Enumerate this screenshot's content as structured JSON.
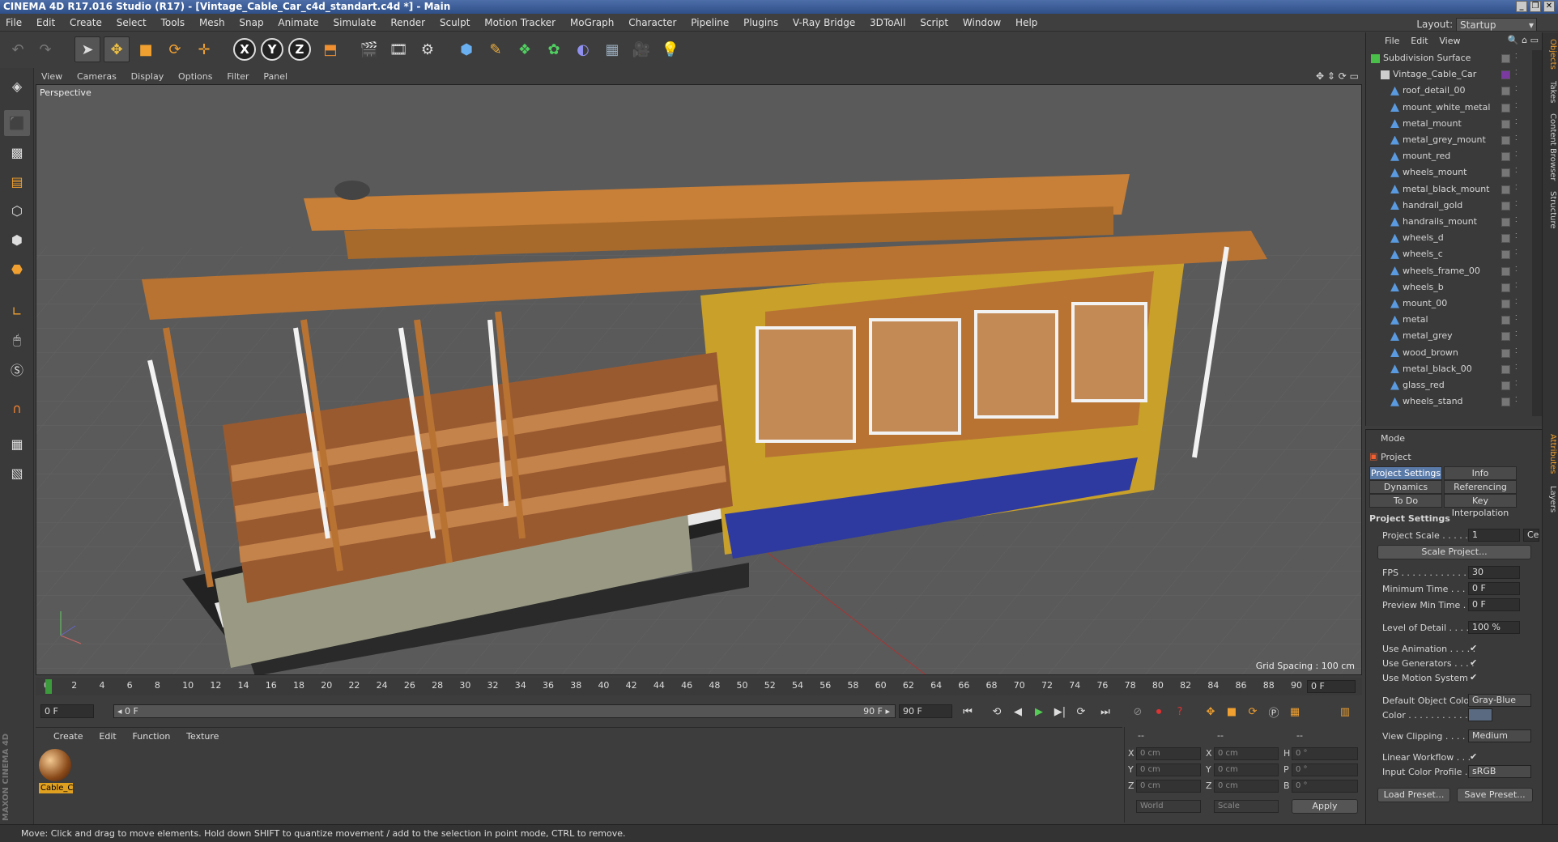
{
  "window": {
    "title": "CINEMA 4D R17.016 Studio (R17) - [Vintage_Cable_Car_c4d_standart.c4d *] - Main",
    "layout_label": "Layout:",
    "layout_value": "Startup",
    "min": "_",
    "max": "❐",
    "close": "✕"
  },
  "menu": [
    "File",
    "Edit",
    "Create",
    "Select",
    "Tools",
    "Mesh",
    "Snap",
    "Animate",
    "Simulate",
    "Render",
    "Sculpt",
    "Motion Tracker",
    "MoGraph",
    "Character",
    "Pipeline",
    "Plugins",
    "V-Ray Bridge",
    "3DToAll",
    "Script",
    "Window",
    "Help"
  ],
  "toolbar": {
    "axis_x": "X",
    "axis_y": "Y",
    "axis_z": "Z"
  },
  "viewport": {
    "menu": [
      "View",
      "Cameras",
      "Display",
      "Options",
      "Filter",
      "Panel"
    ],
    "label": "Perspective",
    "grid_spacing": "Grid Spacing : 100 cm",
    "colors": {
      "bg": "#595959",
      "car_orange": "#b87333",
      "car_yellow": "#c8a02a",
      "blue_stripe": "#2e3aa0",
      "wood": "#9a5a30"
    }
  },
  "timeline": {
    "ticks": [
      "0",
      "2",
      "4",
      "6",
      "8",
      "10",
      "12",
      "14",
      "16",
      "18",
      "20",
      "22",
      "24",
      "26",
      "28",
      "30",
      "32",
      "34",
      "36",
      "38",
      "40",
      "42",
      "44",
      "46",
      "48",
      "50",
      "52",
      "54",
      "56",
      "58",
      "60",
      "62",
      "64",
      "66",
      "68",
      "70",
      "72",
      "74",
      "76",
      "78",
      "80",
      "82",
      "84",
      "86",
      "88",
      "90"
    ],
    "end_field": "0 F"
  },
  "transport": {
    "start": "0 F",
    "range_start": "◂ 0 F",
    "range_end": "90 F ▸",
    "end": "90 F"
  },
  "material": {
    "menu": [
      "Create",
      "Edit",
      "Function",
      "Texture"
    ],
    "item_name": "Cable_C"
  },
  "coords": {
    "header_a": "--",
    "header_b": "--",
    "header_c": "--",
    "x": "X",
    "y": "Y",
    "z": "Z",
    "x_val": "0 cm",
    "y_val": "0 cm",
    "z_val": "0 cm",
    "x2": "X",
    "y2": "Y",
    "z2": "Z",
    "x2_val": "0 cm",
    "y2_val": "0 cm",
    "z2_val": "0 cm",
    "h": "H",
    "p": "P",
    "b": "B",
    "h_val": "0 °",
    "p_val": "0 °",
    "b_val": "0 °",
    "world": "World",
    "scale": "Scale",
    "apply": "Apply"
  },
  "objects": {
    "menu": [
      "File",
      "Edit",
      "View"
    ],
    "items": [
      {
        "name": "Subdivision Surface",
        "level": 0,
        "icon": "subdivision-icon"
      },
      {
        "name": "Vintage_Cable_Car",
        "level": 1,
        "icon": "null-icon"
      },
      {
        "name": "roof_detail_00",
        "level": 2,
        "icon": "polygon-icon"
      },
      {
        "name": "mount_white_metal",
        "level": 2,
        "icon": "polygon-icon"
      },
      {
        "name": "metal_mount",
        "level": 2,
        "icon": "polygon-icon"
      },
      {
        "name": "metal_grey_mount",
        "level": 2,
        "icon": "polygon-icon"
      },
      {
        "name": "mount_red",
        "level": 2,
        "icon": "polygon-icon"
      },
      {
        "name": "wheels_mount",
        "level": 2,
        "icon": "polygon-icon"
      },
      {
        "name": "metal_black_mount",
        "level": 2,
        "icon": "polygon-icon"
      },
      {
        "name": "handrail_gold",
        "level": 2,
        "icon": "polygon-icon"
      },
      {
        "name": "handrails_mount",
        "level": 2,
        "icon": "polygon-icon"
      },
      {
        "name": "wheels_d",
        "level": 2,
        "icon": "polygon-icon"
      },
      {
        "name": "wheels_c",
        "level": 2,
        "icon": "polygon-icon"
      },
      {
        "name": "wheels_frame_00",
        "level": 2,
        "icon": "polygon-icon"
      },
      {
        "name": "wheels_b",
        "level": 2,
        "icon": "polygon-icon"
      },
      {
        "name": "mount_00",
        "level": 2,
        "icon": "polygon-icon"
      },
      {
        "name": "metal",
        "level": 2,
        "icon": "polygon-icon"
      },
      {
        "name": "metal_grey",
        "level": 2,
        "icon": "polygon-icon"
      },
      {
        "name": "wood_brown",
        "level": 2,
        "icon": "polygon-icon"
      },
      {
        "name": "metal_black_00",
        "level": 2,
        "icon": "polygon-icon"
      },
      {
        "name": "glass_red",
        "level": 2,
        "icon": "polygon-icon"
      },
      {
        "name": "wheels_stand",
        "level": 2,
        "icon": "polygon-icon"
      }
    ]
  },
  "attributes": {
    "mode": "Mode",
    "project": "Project",
    "tabs": [
      "Project Settings",
      "Info",
      "Dynamics",
      "Referencing",
      "To Do",
      "Key Interpolation"
    ],
    "section": "Project Settings",
    "project_scale_label": "Project Scale . . . . . .",
    "project_scale_value": "1",
    "project_scale_unit": "Ce",
    "scale_project_btn": "Scale Project...",
    "fps_label": "FPS . . . . . . . . . . . . .",
    "fps_value": "30",
    "min_time_label": "Minimum Time . . . . .",
    "min_time_value": "0 F",
    "preview_min_label": "Preview Min Time . .",
    "preview_min_value": "0 F",
    "lod_label": "Level of Detail . . . . .",
    "lod_value": "100 %",
    "use_anim_label": "Use Animation . . . . .",
    "use_gen_label": "Use Generators . . . .",
    "use_motion_label": "Use Motion System",
    "check": "✔",
    "default_color_label": "Default Object Color",
    "default_color_value": "Gray-Blue",
    "color_label": "Color . . . . . . . . . . .",
    "view_clip_label": "View Clipping . . . . .",
    "view_clip_value": "Medium",
    "linear_wf_label": "Linear Workflow . . .",
    "input_profile_label": "Input Color Profile . .",
    "input_profile_value": "sRGB",
    "load_preset": "Load Preset...",
    "save_preset": "Save Preset..."
  },
  "right_tabs": [
    "Objects",
    "Takes",
    "Content Browser",
    "Structure",
    "Attributes",
    "Layers"
  ],
  "status": "Move: Click and drag to move elements. Hold down SHIFT to quantize movement / add to the selection in point mode, CTRL to remove."
}
